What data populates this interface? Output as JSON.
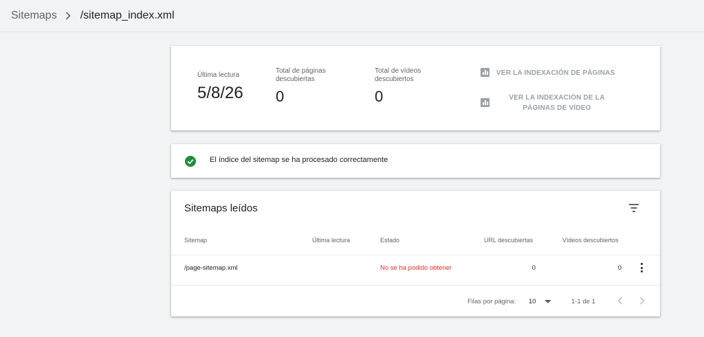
{
  "breadcrumb": {
    "root": "Sitemaps",
    "current": "/sitemap_index.xml"
  },
  "summary": {
    "last_read_label": "Última lectura",
    "last_read_value": "5/8/26",
    "pages_label_line1": "Total de páginas",
    "pages_label_line2": "descubiertas",
    "pages_value": "0",
    "videos_label_line1": "Total de vídeos",
    "videos_label_line2": "descubiertos",
    "videos_value": "0",
    "action_pages": "VER LA INDEXACIÓN DE PÁGINAS",
    "action_videos_line1": "VER LA INDEXACIÓN DE LA",
    "action_videos_line2": "PÁGINAS DE VÍDEO",
    "action_icon": "bar-chart-icon"
  },
  "status": {
    "icon": "check-circle-icon",
    "color": "#1e8e3e",
    "message": "El índice del sitemap se ha procesado correctamente"
  },
  "table": {
    "title": "Sitemaps leídos",
    "filter_icon": "filter-icon",
    "columns": [
      "Sitemap",
      "Última lectura",
      "Estado",
      "URL descubiertas",
      "Vídeos descubiertos"
    ],
    "rows": [
      {
        "sitemap": "/page-sitemap.xml",
        "last_read": "",
        "status": "No se ha podido obtener",
        "urls": "0",
        "videos": "0"
      }
    ],
    "error_color": "#d93025",
    "pager": {
      "rows_per_page_label": "Filas por página:",
      "rows_per_page_value": "10",
      "range": "1-1 de 1"
    }
  }
}
